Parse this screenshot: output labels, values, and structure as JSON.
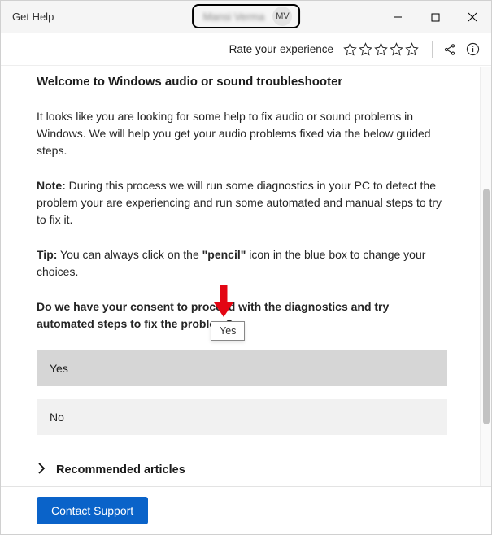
{
  "app": {
    "title": "Get Help"
  },
  "user": {
    "name": "Mansi Verma",
    "initials": "MV"
  },
  "toolbar": {
    "rate_label": "Rate your experience"
  },
  "content": {
    "heading": "Welcome to Windows audio or sound troubleshooter",
    "intro": "It looks like you are looking for some help to fix audio or sound problems in Windows. We will help you get your audio problems fixed via the below guided steps.",
    "note_label": "Note:",
    "note_text": " During this process we will run some diagnostics in your PC to detect the problem your are experiencing and run some automated  and manual steps to try to fix it.",
    "tip_label": "Tip:",
    "tip_text_1": " You can always click on the ",
    "tip_pencil": "\"pencil\"",
    "tip_text_2": " icon in the blue box to change your choices.",
    "consent": "Do we have your consent to proceed with the diagnostics and try automated steps to fix the problem?",
    "options": {
      "yes": "Yes",
      "no": "No"
    },
    "recommended": "Recommended articles"
  },
  "tooltip": {
    "text": "Yes"
  },
  "footer": {
    "contact": "Contact Support"
  }
}
